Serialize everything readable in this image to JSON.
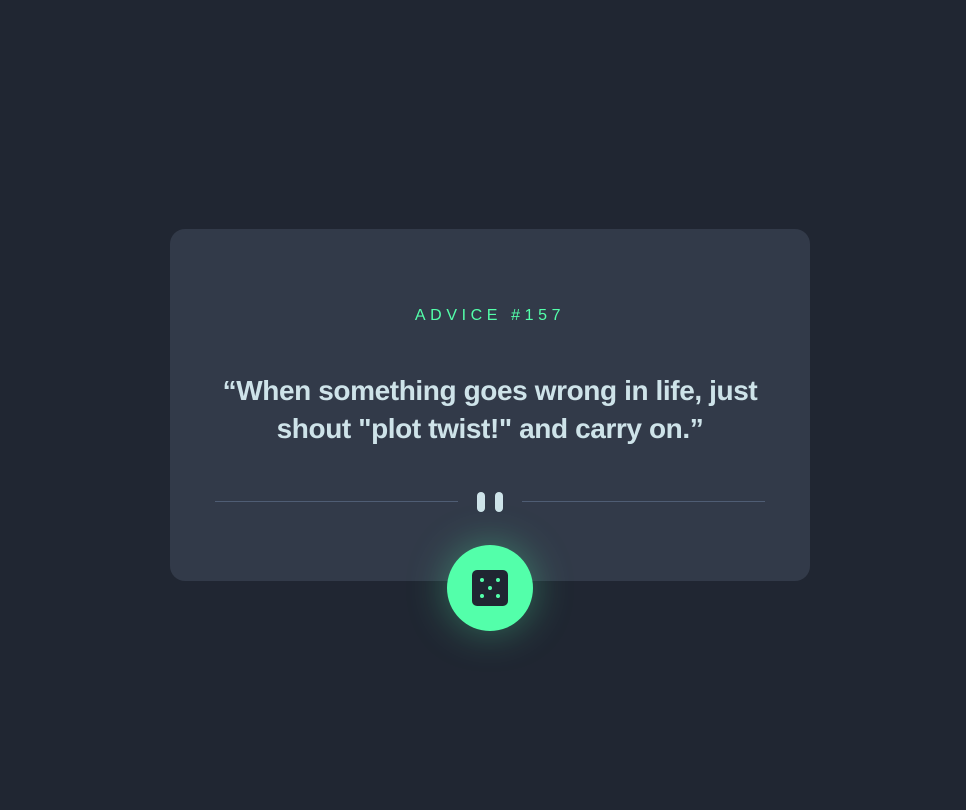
{
  "card": {
    "advice_label": "ADVICE #157",
    "quote": "“When something goes wrong in life, just shout \"plot twist!\" and carry on.”"
  },
  "icons": {
    "divider": "pause-icon",
    "button": "dice-icon"
  },
  "colors": {
    "background": "#202632",
    "card": "#323a49",
    "accent": "#53ffaa",
    "text": "#cee3e9",
    "divider": "#4f5d74"
  }
}
